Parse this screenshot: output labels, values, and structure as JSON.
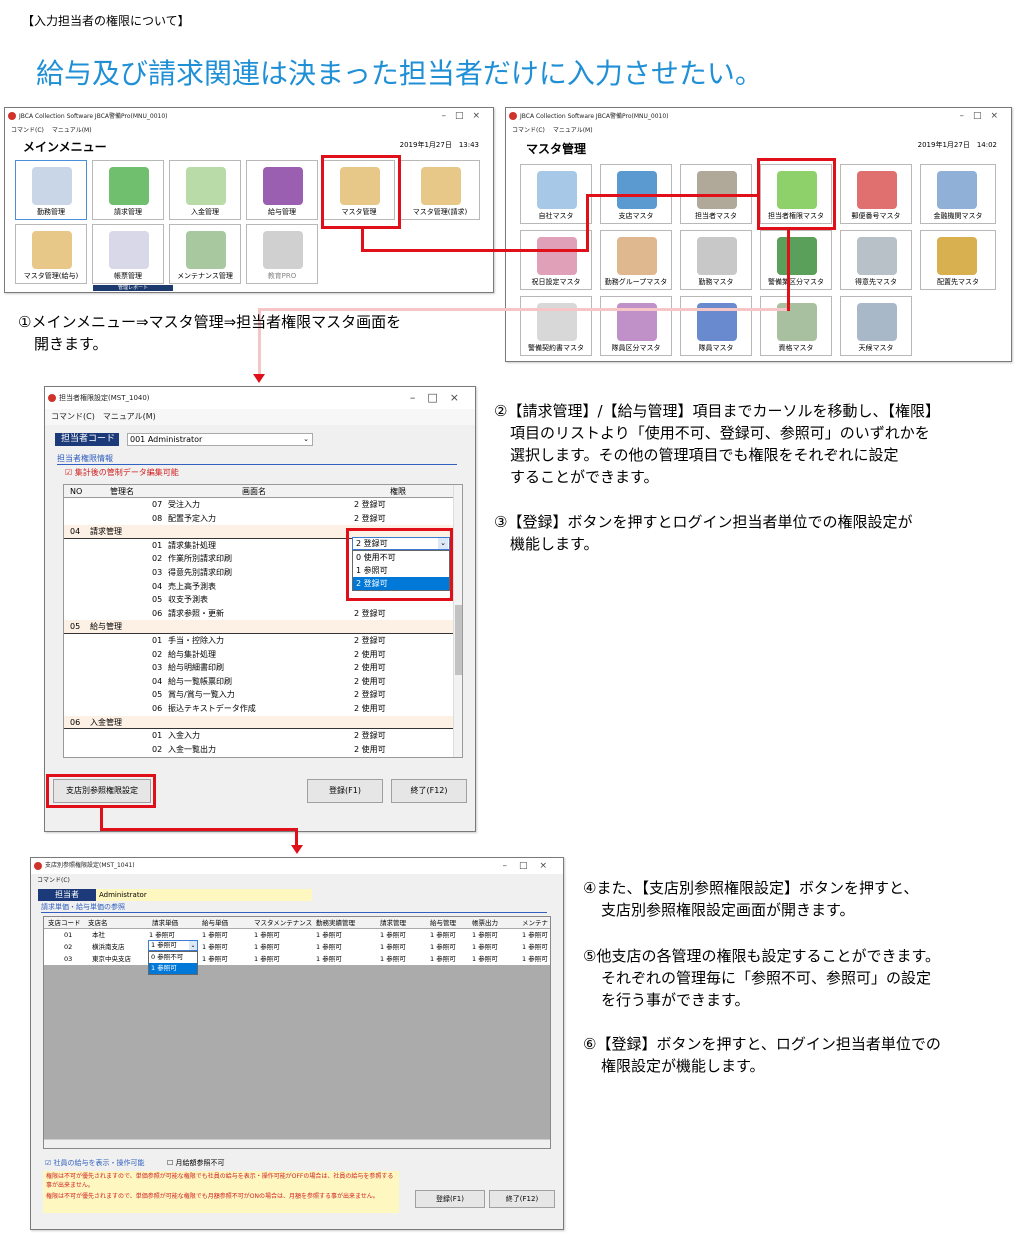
{
  "header": {
    "bracket_title": "【入力担当者の権限について】",
    "headline": "給与及び請求関連は決まった担当者だけに入力させたい。"
  },
  "main_menu": {
    "window_title": "JBCA Collection Software JBCA警備Pro(MNU_0010)",
    "menu": [
      "コマンド(C)",
      "マニュアル(M)"
    ],
    "title": "メインメニュー",
    "datetime": "2019年1月27日　13:43",
    "tiles": [
      "勤務管理",
      "請求管理",
      "入金管理",
      "給与管理",
      "マスタ管理",
      "マスタ管理(請求)",
      "マスタ管理(給与)",
      "帳票管理",
      "メンテナンス管理",
      "教育PRO"
    ],
    "footer_fragment": "管理レポート"
  },
  "master_menu": {
    "window_title": "JBCA Collection Software JBCA警備Pro(MNU_0010)",
    "menu": [
      "コマンド(C)",
      "マニュアル(M)"
    ],
    "title": "マスタ管理",
    "datetime": "2019年1月27日　14:02",
    "tiles": [
      "自社マスタ",
      "支店マスタ",
      "担当者マスタ",
      "担当者権限マスタ",
      "郵便番号マスタ",
      "金融機関マスタ",
      "祝日設定マスタ",
      "勤務グループマスタ",
      "勤務マスタ",
      "警備業区分マスタ",
      "得意先マスタ",
      "配置先マスタ",
      "警備契約書マスタ",
      "隊員区分マスタ",
      "隊員マスタ",
      "資格マスタ",
      "天候マスタ"
    ]
  },
  "notes": {
    "n1": [
      "①メインメニュー⇒マスタ管理⇒担当者権限マスタ画面を",
      "開きます。"
    ],
    "n2": [
      "②【請求管理】/【給与管理】項目までカーソルを移動し、【権限】",
      "項目のリストより「使用不可、登録可、参照可」のいずれかを",
      "選択します。その他の管理項目でも権限をそれぞれに設定",
      "することができます。"
    ],
    "n3": [
      "③【登録】ボタンを押すとログイン担当者単位での権限設定が",
      "機能します。"
    ],
    "n4": [
      "④また、【支店別参照権限設定】ボタンを押すと、",
      "支店別参照権限設定画面が開きます。"
    ],
    "n5": [
      "⑤他支店の各管理の権限も設定することができます。",
      "それぞれの管理毎に「参照不可、参照可」の設定",
      "を行う事ができます。"
    ],
    "n6": [
      "⑥【登録】ボタンを押すと、ログイン担当者単位での",
      "権限設定が機能します。"
    ]
  },
  "perm_window": {
    "window_title": "担当者権限設定(MST_1040)",
    "menu": [
      "コマンド(C)",
      "マニュアル(M)"
    ],
    "code_label": "担当者コード",
    "code_value": "001 Administrator",
    "group_label": "担当者権限情報",
    "checkbox_label": "集計後の管制データ編集可能",
    "columns": [
      "NO",
      "管理名",
      "画面名",
      "権限"
    ],
    "rows": [
      {
        "no": "",
        "name": "",
        "code": "07",
        "screen": "受注入力",
        "perm": "2 登録可"
      },
      {
        "no": "",
        "name": "",
        "code": "08",
        "screen": "配置予定入力",
        "perm": "2 登録可"
      },
      {
        "no": "04",
        "name": "請求管理",
        "code": "",
        "screen": "",
        "perm": ""
      },
      {
        "no": "",
        "name": "",
        "code": "01",
        "screen": "請求集計処理",
        "perm": "2 登録可"
      },
      {
        "no": "",
        "name": "",
        "code": "02",
        "screen": "作業所別請求印刷",
        "perm": ""
      },
      {
        "no": "",
        "name": "",
        "code": "03",
        "screen": "得意先別請求印刷",
        "perm": ""
      },
      {
        "no": "",
        "name": "",
        "code": "04",
        "screen": "売上高予測表",
        "perm": ""
      },
      {
        "no": "",
        "name": "",
        "code": "05",
        "screen": "収支予測表",
        "perm": ""
      },
      {
        "no": "",
        "name": "",
        "code": "06",
        "screen": "請求参照・更新",
        "perm": "2 登録可"
      },
      {
        "no": "05",
        "name": "給与管理",
        "code": "",
        "screen": "",
        "perm": ""
      },
      {
        "no": "",
        "name": "",
        "code": "01",
        "screen": "手当・控除入力",
        "perm": "2 登録可"
      },
      {
        "no": "",
        "name": "",
        "code": "02",
        "screen": "給与集計処理",
        "perm": "2 使用可"
      },
      {
        "no": "",
        "name": "",
        "code": "03",
        "screen": "給与明細書印刷",
        "perm": "2 使用可"
      },
      {
        "no": "",
        "name": "",
        "code": "04",
        "screen": "給与一覧帳票印刷",
        "perm": "2 使用可"
      },
      {
        "no": "",
        "name": "",
        "code": "05",
        "screen": "賞与/賞与一覧入力",
        "perm": "2 登録可"
      },
      {
        "no": "",
        "name": "",
        "code": "06",
        "screen": "振込テキストデータ作成",
        "perm": "2 使用可"
      },
      {
        "no": "06",
        "name": "入金管理",
        "code": "",
        "screen": "",
        "perm": ""
      },
      {
        "no": "",
        "name": "",
        "code": "01",
        "screen": "入金入力",
        "perm": "2 登録可"
      },
      {
        "no": "",
        "name": "",
        "code": "02",
        "screen": "入金一覧出力",
        "perm": "2 使用可"
      }
    ],
    "dropdown_options": [
      "0 使用不可",
      "1 参照可",
      "2 登録可"
    ],
    "branch_button": "支店別参照権限設定",
    "register_button": "登録(F1)",
    "close_button": "終了(F12)"
  },
  "branch_window": {
    "window_title": "支店別参照権限設定(MST_1041)",
    "menu": [
      "コマンド(C)"
    ],
    "staff_label": "担当者",
    "staff_value": "Administrator",
    "section_label": "請求単価・給与単価の参照",
    "columns": [
      "支店コード",
      "支店名",
      "請求単価",
      "給与単価",
      "マスタメンテナンス",
      "勤務実績管理",
      "請求管理",
      "給与管理",
      "帳票出力",
      "メンテナ"
    ],
    "rows": [
      {
        "code": "01",
        "name": "本社",
        "vals": [
          "1 参照可",
          "1 参照可",
          "1 参照可",
          "1 参照可",
          "1 参照可",
          "1 参照可",
          "1 参照可",
          "1 参照可"
        ]
      },
      {
        "code": "02",
        "name": "横浜南支店",
        "vals": [
          "1 参照可",
          "1 参照可",
          "1 参照可",
          "1 参照可",
          "1 参照可",
          "1 参照可",
          "1 参照可",
          "1 参照可"
        ]
      },
      {
        "code": "03",
        "name": "東京中央支店",
        "vals": [
          "1 参照可",
          "1 参照可",
          "1 参照可",
          "1 参照可",
          "1 参照可",
          "1 参照可",
          "1 参照可",
          "1 参照可"
        ]
      }
    ],
    "dropdown_options": [
      "0 参照不可",
      "1 参照可"
    ],
    "check1": "社員の給与を表示・操作可能",
    "check2": "月給額参照不可",
    "warn1": "権限は不可が優先されますので、単価参照が可能な権限でも社員の給与を表示・操作可能がOFFの場合は、社員の給与を参照する事が出来ません。",
    "warn2": "権限は不可が優先されますので、単価参照が可能な権限でも月額参照不可がONの場合は、月額を参照する事が出来ません。",
    "register_button": "登録(F1)",
    "close_button": "終了(F12)"
  }
}
